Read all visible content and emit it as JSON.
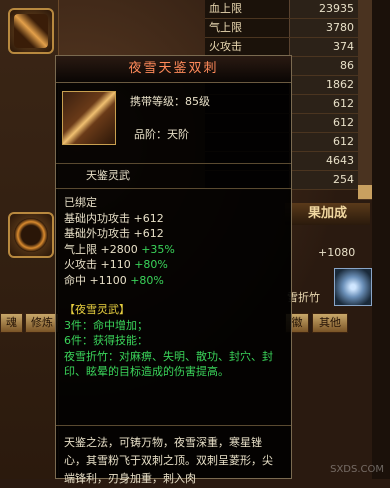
{
  "stats": [
    {
      "label": "血上限",
      "value": "23935"
    },
    {
      "label": "气上限",
      "value": "3780"
    },
    {
      "label": "火攻击",
      "value": "374"
    },
    {
      "label": "",
      "value": "86"
    },
    {
      "label": "",
      "value": "1862"
    },
    {
      "label": "",
      "value": "612"
    },
    {
      "label": "",
      "value": "612"
    },
    {
      "label": "",
      "value": "612"
    },
    {
      "label": "",
      "value": "4643"
    },
    {
      "label": "",
      "value": "254"
    }
  ],
  "set_header": "果加成",
  "set_value": "+1080",
  "skill_label": "雪折竹",
  "left_tabs": [
    "魂",
    "修炼"
  ],
  "mid_tab": "徽",
  "other_tab": "其他",
  "tooltip": {
    "title": "夜雪天鉴双刺",
    "carry_level": "携带等级：85级",
    "grade": "品阶：天阶",
    "subtitle": "天鉴灵武",
    "bound": "已绑定",
    "base_inner": "基础内功攻击 +612",
    "base_outer": "基础外功攻击 +612",
    "qi_label": "气上限 +2800",
    "qi_pct": "+35%",
    "fire_label": "火攻击 +110",
    "fire_pct": "+80%",
    "hit_label": "命中 +1100",
    "hit_pct": "+80%",
    "set_name": "【夜雪灵武】",
    "set3": "3件：命中增加；",
    "set6": "6件：获得技能：",
    "skill_desc": "夜雪折竹：对麻痹、失明、散功、封穴、封印、眩晕的目标造成的伤害提高。",
    "desc": "天鉴之法，可铸万物，夜雪深重，寒星锉心，其雪粉飞于双刺之顶。双刺呈菱形，尖端锋利，刃身加重，刺入肉"
  },
  "watermark": "SXDS.COM"
}
